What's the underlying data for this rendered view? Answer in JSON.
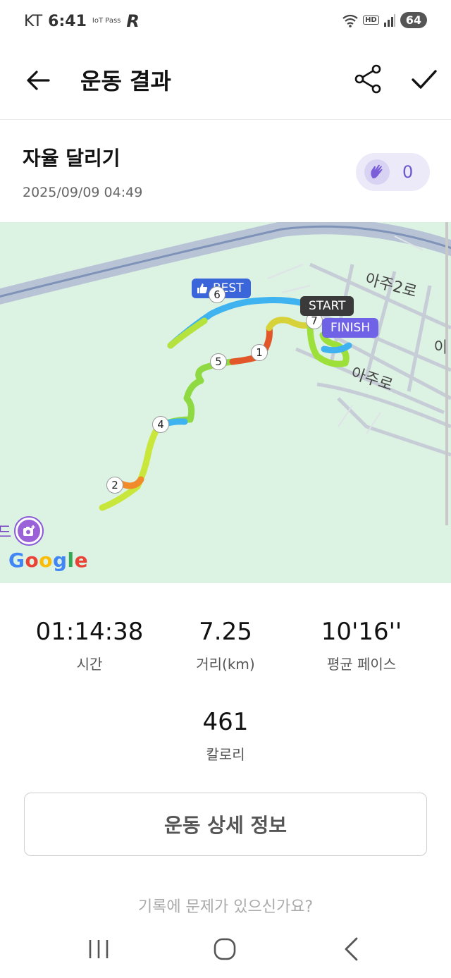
{
  "status_bar": {
    "carrier": "KT",
    "time": "6:41",
    "iot_label": "IoT Pass",
    "app_glyph": "R",
    "hd_label": "HD",
    "battery": "64"
  },
  "app_bar": {
    "title": "운동 결과",
    "back_icon": "arrow-left-icon",
    "share_icon": "share-icon",
    "confirm_icon": "check-icon"
  },
  "workout": {
    "title": "자율 달리기",
    "datetime": "2025/09/09 04:49",
    "clap_count": "0"
  },
  "map": {
    "road_labels": [
      "아주2로",
      "아주로",
      "아"
    ],
    "start_label": "START",
    "finish_label": "FINISH",
    "best_label": "BEST",
    "km_markers": [
      "1",
      "2",
      "4",
      "5",
      "6",
      "7"
    ],
    "provider": "Google",
    "edge_text": "드"
  },
  "stats": [
    {
      "value": "01:14:38",
      "label": "시간"
    },
    {
      "value": "7.25",
      "label": "거리(km)"
    },
    {
      "value": "10'16''",
      "label": "평균 페이스"
    },
    {
      "value": "461",
      "label": "칼로리"
    }
  ],
  "detail_button": "운동 상세 정보",
  "problem_link": "기록에 문제가 있으신가요?",
  "colors": {
    "accent": "#7062e6",
    "map_bg": "#dcf2e3",
    "route_fast": "#3fb3f0",
    "route_mid": "#b8e63a",
    "route_slow": "#e2572a"
  }
}
